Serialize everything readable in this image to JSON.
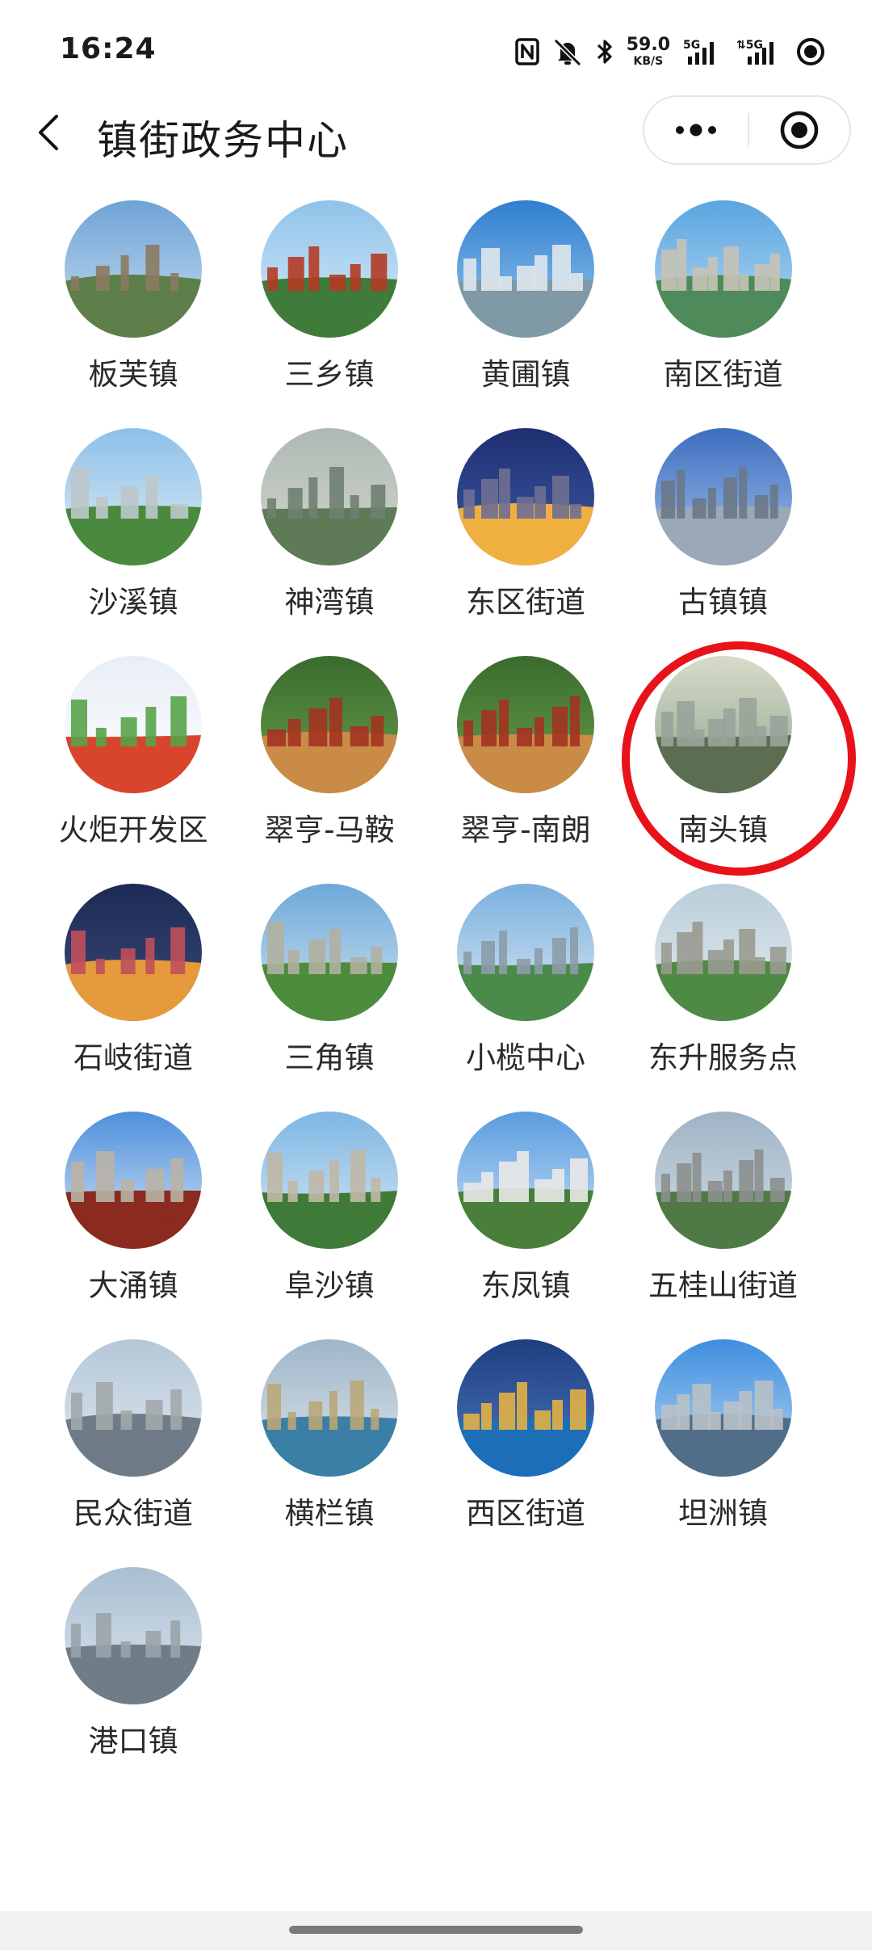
{
  "status_bar": {
    "time": "16:24",
    "net_speed_value": "59.0",
    "net_speed_unit": "KB/S",
    "icons": [
      "nfc-icon",
      "mute-icon",
      "bluetooth-icon",
      "signal-5g-icon",
      "signal-5g-icon",
      "record-icon"
    ]
  },
  "nav": {
    "title": "镇街政务中心",
    "back_icon": "chevron-left-icon",
    "more_icon": "more-dots-icon",
    "close_icon": "target-circle-icon"
  },
  "towns": [
    {
      "name": "板芙镇"
    },
    {
      "name": "三乡镇"
    },
    {
      "name": "黄圃镇"
    },
    {
      "name": "南区街道"
    },
    {
      "name": "沙溪镇"
    },
    {
      "name": "神湾镇"
    },
    {
      "name": "东区街道"
    },
    {
      "name": "古镇镇"
    },
    {
      "name": "火炬开发区"
    },
    {
      "name": "翠亨-马鞍"
    },
    {
      "name": "翠亨-南朗"
    },
    {
      "name": "南头镇"
    },
    {
      "name": "石岐街道"
    },
    {
      "name": "三角镇"
    },
    {
      "name": "小榄中心"
    },
    {
      "name": "东升服务点"
    },
    {
      "name": "大涌镇"
    },
    {
      "name": "阜沙镇"
    },
    {
      "name": "东凤镇"
    },
    {
      "name": "五桂山街道"
    },
    {
      "name": "民众街道"
    },
    {
      "name": "横栏镇"
    },
    {
      "name": "西区街道"
    },
    {
      "name": "坦洲镇"
    },
    {
      "name": "港口镇"
    }
  ],
  "highlighted": "南头镇",
  "colors": {
    "highlight": "#e8121a",
    "text": "#2a2a2a"
  }
}
